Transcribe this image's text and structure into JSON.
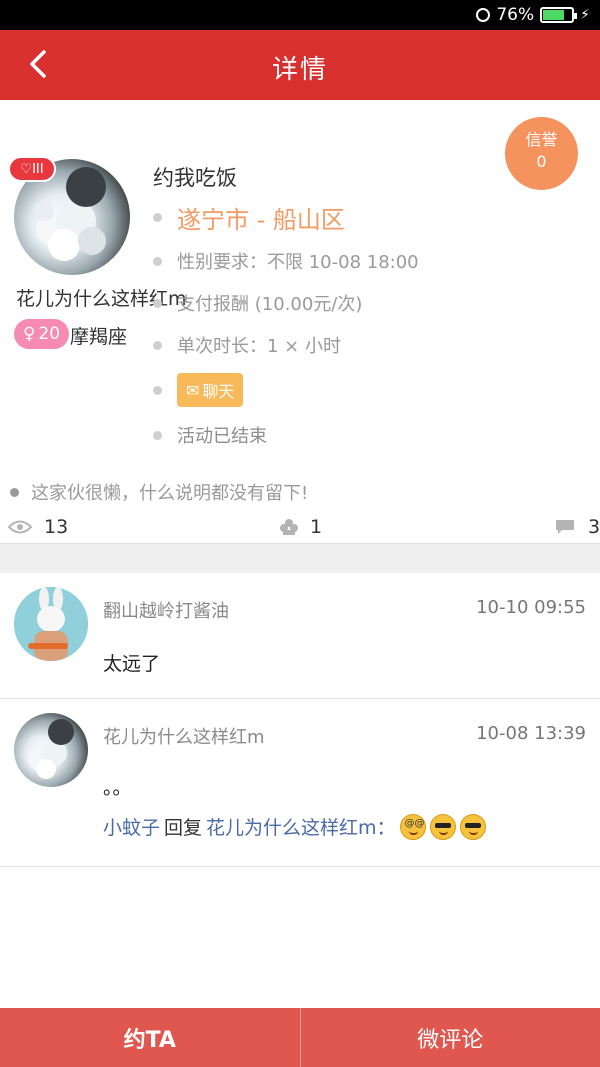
{
  "statusbar": {
    "battery": "76%"
  },
  "header": {
    "title": "详情"
  },
  "credit": {
    "label": "信誉",
    "value": "0"
  },
  "user": {
    "vip": "III",
    "name": "花儿为什么这样红m",
    "age": "20",
    "zodiac": "摩羯座"
  },
  "event": {
    "title": "约我吃饭",
    "location": "遂宁市 - 船山区",
    "gender": "性别要求：不限 10-08 18:00",
    "pay": "支付报酬 (10.00元/次)",
    "duration": "单次时长：1 × 小时",
    "chat_label": "聊天",
    "status": "活动已结束"
  },
  "description": "这家伙很懒，什么说明都没有留下!",
  "stats": {
    "views": "13",
    "likes": "1",
    "comments": "3"
  },
  "comments": [
    {
      "name": "翻山越岭打酱油",
      "time": "10-10 09:55",
      "text": "太远了"
    },
    {
      "name": "花儿为什么这样红m",
      "time": "10-08 13:39",
      "text": "。。",
      "reply": {
        "from": "小蚊子",
        "verb": "回复",
        "to": "花儿为什么这样红m："
      }
    }
  ],
  "bottom": {
    "left": "约TA",
    "right": "微评论"
  }
}
